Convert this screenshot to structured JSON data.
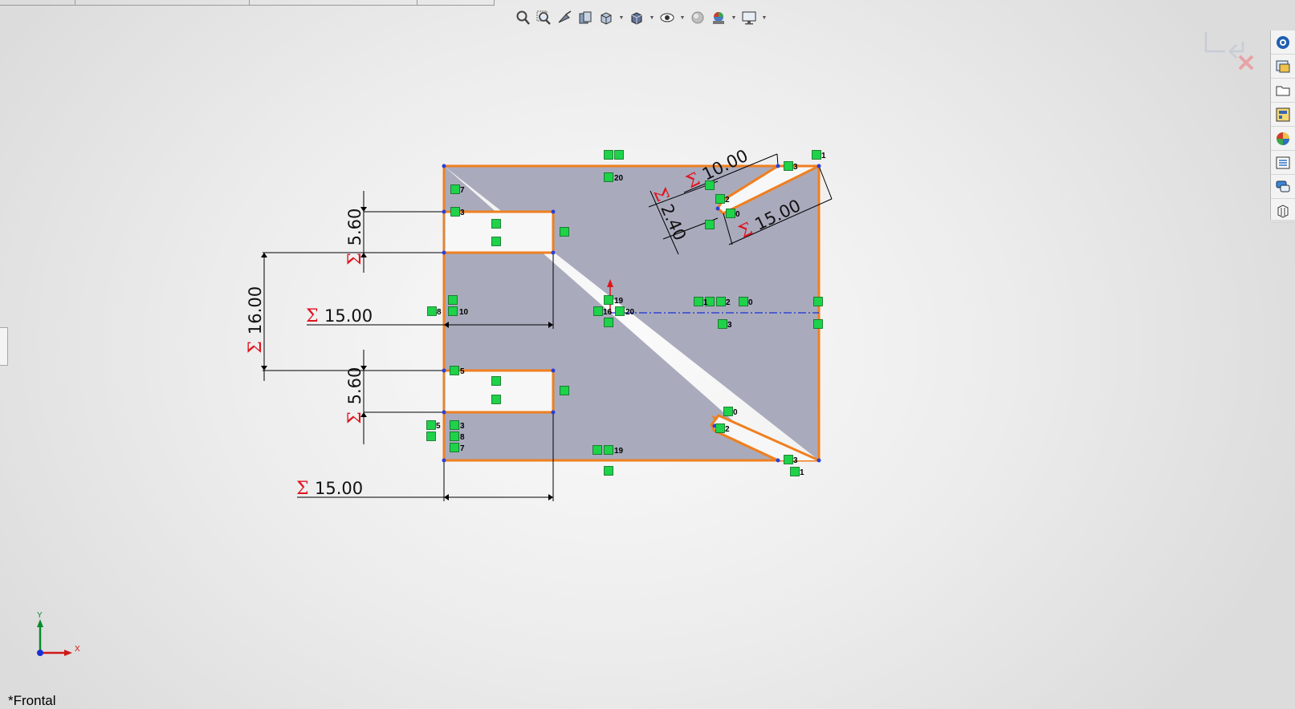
{
  "toolbar": {
    "items": [
      "zoom-to-fit-icon",
      "zoom-to-area-icon",
      "previous-view-icon",
      "section-view-icon",
      "view-orientation-icon",
      "display-style-icon",
      "hide-show-items-icon",
      "edit-appearance-icon",
      "apply-scene-icon",
      "view-settings-icon"
    ]
  },
  "confirmation_corner": {
    "exit_icon": "exit-sketch-icon",
    "cancel_icon": "cancel-sketch-icon"
  },
  "task_pane": {
    "items": [
      "solidworks-resources-icon",
      "design-library-icon",
      "file-explorer-icon",
      "view-palette-icon",
      "appearances-scenes-icon",
      "custom-properties-icon",
      "forum-icon",
      "toolbox-icon"
    ]
  },
  "sketch": {
    "fill_color": "#a9abbd",
    "outline_color": "#f07f1f",
    "dimensions": {
      "slot_top_height": "5.60",
      "slot_bottom_height": "5.60",
      "slot_spacing": "16.00",
      "slot_depth_top": "15.00",
      "slot_depth_bottom": "15.00",
      "top_taper_width": "10.00",
      "top_taper_gap": "2.40",
      "top_taper_length": "15.00"
    },
    "relation_labels": {
      "r7a": "7",
      "r3a": "3",
      "r8": "8",
      "r10": "10",
      "r5a": "5",
      "r5b": "5",
      "r3b": "3",
      "r8b": "8",
      "r7b": "7",
      "r20a": "20",
      "r19a": "19",
      "r16": "16",
      "r20b": "20",
      "r19b": "19",
      "r3c": "3",
      "r1a": "1",
      "r2a": "2",
      "r0a": "0",
      "r1b": "1",
      "r2b": "2",
      "r0b": "0",
      "r3d": "3",
      "r0c": "0",
      "r2c": "2",
      "r3e": "3",
      "r1c": "1"
    }
  },
  "triad": {
    "x_label": "X",
    "y_label": "Y"
  },
  "view": {
    "label": "*Frontal"
  }
}
